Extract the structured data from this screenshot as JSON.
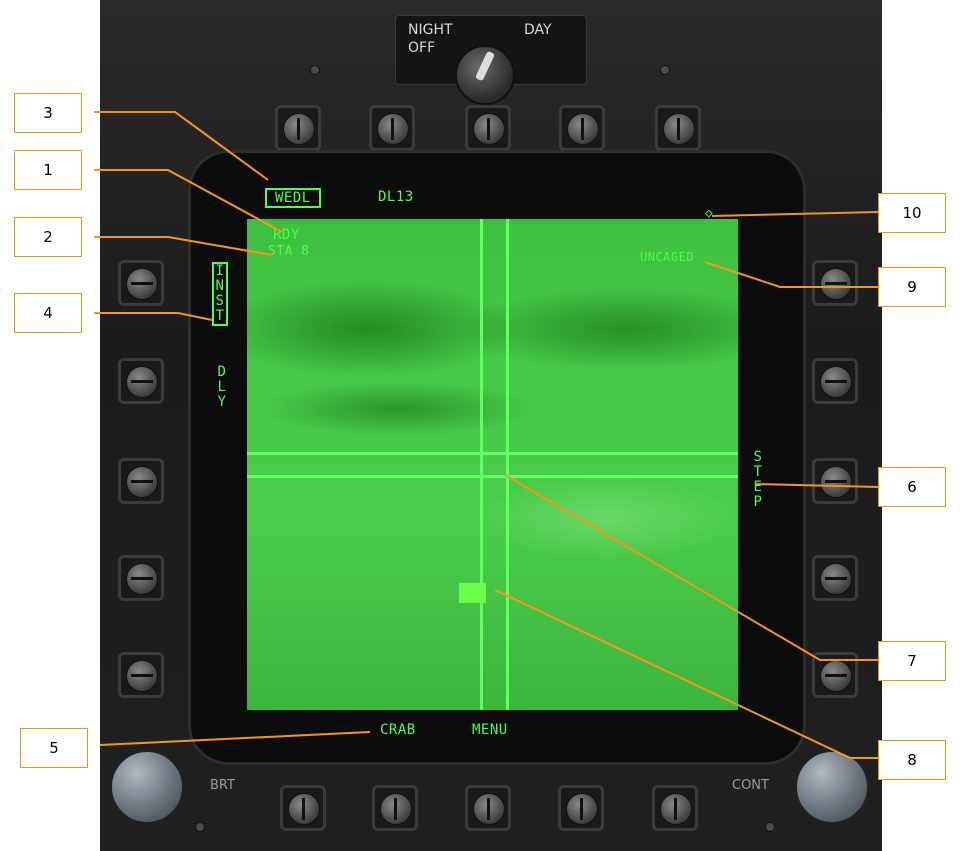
{
  "panel": {
    "switch_night": "NIGHT",
    "switch_day": "DAY",
    "switch_off": "OFF",
    "brt_label": "BRT",
    "cont_label": "CONT"
  },
  "ddi": {
    "weapon_mode": "WEDL",
    "datalink": "DL13",
    "ready": "RDY",
    "station": "STA 8",
    "inst": "INST",
    "dly": "DLY",
    "status": "UNCAGED",
    "step": "STEP",
    "crab": "CRAB",
    "menu": "MENU",
    "symbol_icon": "diamond-icon",
    "video_color": "#46c846",
    "symbology_color": "#4dff4d"
  },
  "callouts": [
    "1",
    "2",
    "3",
    "4",
    "5",
    "6",
    "7",
    "8",
    "9",
    "10"
  ],
  "colors": {
    "callout_border": "#e8960c",
    "leader_line": "#f7941d"
  }
}
